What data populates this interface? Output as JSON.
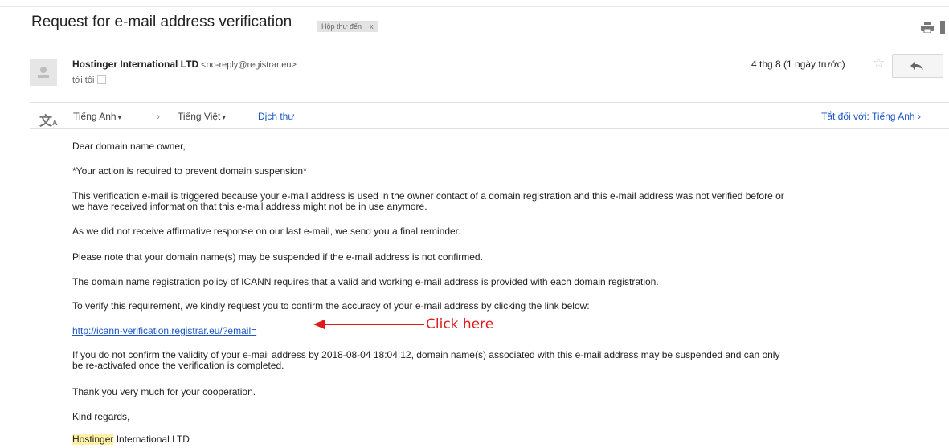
{
  "email": {
    "subject": "Request for e-mail address verification",
    "label": "Hộp thư đến",
    "label_close": "x",
    "sender_name": "Hostinger International LTD",
    "sender_email": "<no-reply@registrar.eu>",
    "recipient": "tới tôi",
    "date": "4 thg 8 (1 ngày trước)",
    "star": "☆"
  },
  "translate": {
    "from_lang": "Tiếng Anh",
    "arrow": "›",
    "to_lang": "Tiếng Việt",
    "translate_link": "Dịch thư",
    "turn_off": "Tắt đối với: Tiếng Anh"
  },
  "body": {
    "greeting": "Dear domain name owner,",
    "p_action": "*Your action is required to prevent domain suspension*",
    "p_verify_1": "This verification e-mail is triggered because your e-mail address is used in the owner contact of a domain registration and this e-mail address was not verified before or",
    "p_verify_2": "we have received information that this e-mail address might not be in use anymore.",
    "p_reminder": "As we did not receive affirmative response on our last e-mail, we send you a final reminder.",
    "p_suspend": "Please note that your domain name(s) may be suspended if the e-mail address is not confirmed.",
    "p_policy": "The domain name registration policy of ICANN requires that a valid and working e-mail address is provided with each domain registration.",
    "p_request": "To verify this requirement, we kindly request you to confirm the accuracy of your e-mail address by clicking the link below:",
    "link": "http://icann-verification.registrar.eu/?email=",
    "p_confirm_1": "If you do not confirm the validity of your e-mail address by 2018-08-04 18:04:12, domain name(s) associated with this e-mail address may be suspended and can only",
    "p_confirm_2": "be re-activated once the verification is completed.",
    "p_thanks": "Thank you very much for your cooperation.",
    "p_regards": "Kind regards,",
    "signature_highlight": "Hostinger",
    "signature_rest": " International LTD"
  },
  "annotation": {
    "text": "Click here",
    "color": "#e01b1b"
  }
}
